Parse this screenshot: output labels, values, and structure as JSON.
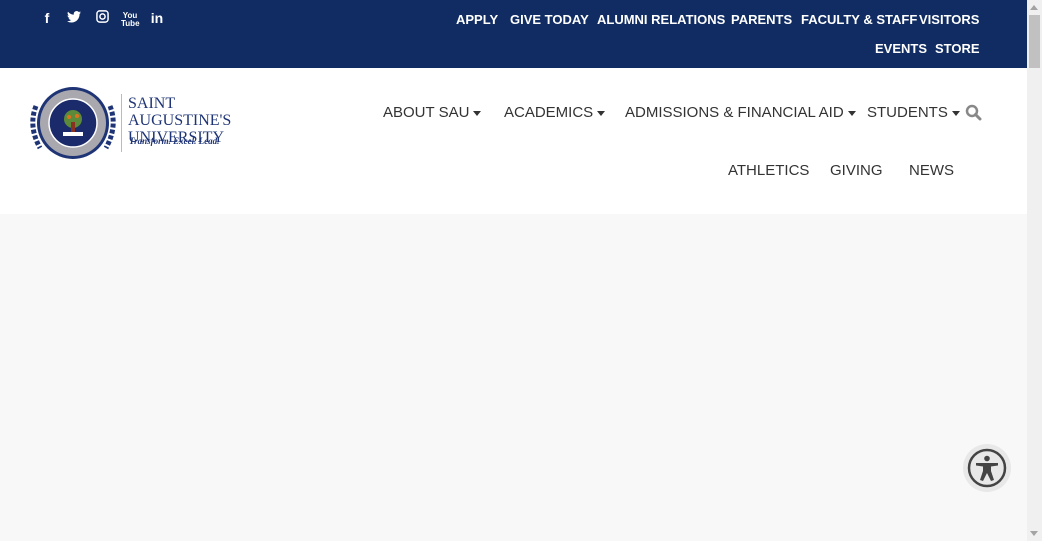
{
  "topbar": {
    "color": "#102c62",
    "social": [
      "facebook-icon",
      "twitter-icon",
      "instagram-icon",
      "youtube-icon",
      "linkedin-icon"
    ],
    "links": [
      "APPLY",
      "GIVE TODAY",
      "ALUMNI RELATIONS",
      "PARENTS",
      "FACULTY & STAFF",
      "VISITORS",
      "EVENTS",
      "STORE"
    ]
  },
  "logo": {
    "name_line1": "SAINT AUGUSTINE'S",
    "name_line2": "UNIVERSITY",
    "tagline": "Transform. Excel. Lead.",
    "seal_text": "SAINT AUGUSTINE'S UNIVERSITY"
  },
  "nav": {
    "items": [
      "ABOUT SAU",
      "ACADEMICS",
      "ADMISSIONS & FINANCIAL AID",
      "STUDENTS",
      "ATHLETICS",
      "GIVING",
      "NEWS"
    ]
  }
}
